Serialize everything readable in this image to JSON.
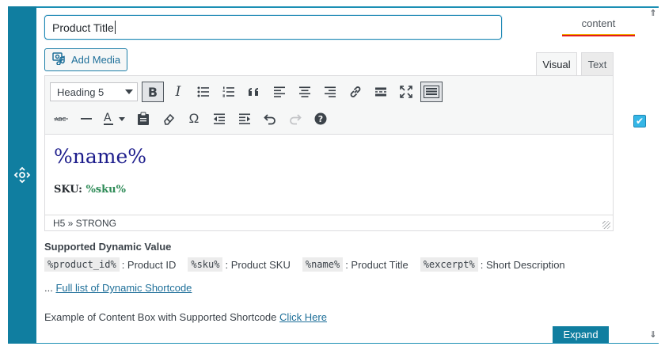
{
  "title_input": {
    "value": "Product Title"
  },
  "content_tag": "content",
  "add_media_label": "Add Media",
  "tabs": {
    "visual": "Visual",
    "text": "Text"
  },
  "format_select": "Heading 5",
  "editor": {
    "heading": "%name%",
    "sku_label": "SKU:",
    "sku_value": "%sku%"
  },
  "status_path": "H5 » STRONG",
  "supported": {
    "title": "Supported Dynamic Value",
    "items": [
      {
        "code": "%product_id%",
        "desc": ": Product ID"
      },
      {
        "code": "%sku%",
        "desc": ": Product SKU"
      },
      {
        "code": "%name%",
        "desc": ": Product Title"
      },
      {
        "code": "%excerpt%",
        "desc": ": Short Description"
      }
    ]
  },
  "full_list": {
    "prefix": "... ",
    "link": "Full list of Dynamic Shortcode"
  },
  "example": {
    "text": "Example of Content Box with Supported Shortcode ",
    "link": "Click Here"
  },
  "expand_label": "Expand",
  "colors": {
    "accent": "#107ea0",
    "link": "#1e6f99",
    "heading": "#1d1d8c",
    "sku": "#2e8b57"
  }
}
